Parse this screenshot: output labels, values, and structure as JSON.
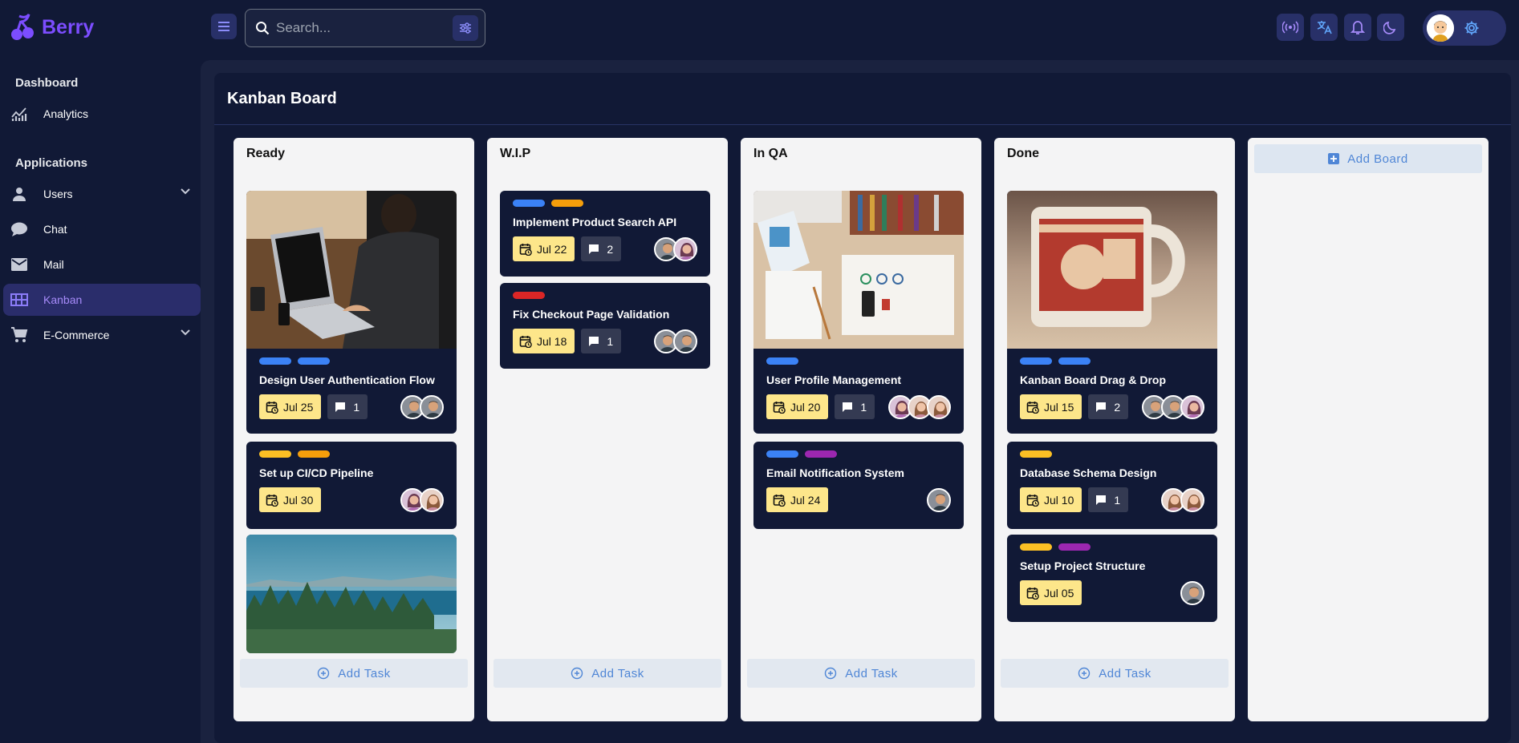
{
  "app": {
    "name": "Berry"
  },
  "search": {
    "placeholder": "Search..."
  },
  "sidebar": {
    "sections": [
      {
        "title": "Dashboard",
        "items": [
          {
            "label": "Analytics",
            "icon": "analytics-icon"
          }
        ]
      },
      {
        "title": "Applications",
        "items": [
          {
            "label": "Users",
            "icon": "user-icon",
            "expandable": true
          },
          {
            "label": "Chat",
            "icon": "chat-icon"
          },
          {
            "label": "Mail",
            "icon": "mail-icon"
          },
          {
            "label": "Kanban",
            "icon": "kanban-icon",
            "active": true
          },
          {
            "label": "E-Commerce",
            "icon": "cart-icon",
            "expandable": true
          }
        ]
      }
    ]
  },
  "header": {
    "icons": [
      "hamburger-icon",
      "tune-icon",
      "broadcast-icon",
      "translate-icon",
      "bell-icon",
      "moon-icon",
      "settings-icon"
    ]
  },
  "page": {
    "title": "Kanban Board"
  },
  "board": {
    "add_task_label": "Add Task",
    "add_board_label": "Add Board",
    "columns": [
      {
        "title": "Ready",
        "cards": [
          {
            "image": "laptop",
            "tags": [
              "blue",
              "blue"
            ],
            "title": "Design User Authentication Flow",
            "date": "Jul 25",
            "comments": "1",
            "avatars": 2
          },
          {
            "tags": [
              "yellow",
              "orange"
            ],
            "title": "Set up CI/CD Pipeline",
            "date": "Jul 30",
            "avatars": 2
          },
          {
            "image": "forest-lake"
          }
        ]
      },
      {
        "title": "W.I.P",
        "cards": [
          {
            "tags": [
              "blue",
              "orange"
            ],
            "title": "Implement Product Search API",
            "date": "Jul 22",
            "comments": "2",
            "avatars": 2
          },
          {
            "tags": [
              "red"
            ],
            "title": "Fix Checkout Page Validation",
            "date": "Jul 18",
            "comments": "1",
            "avatars": 2
          }
        ]
      },
      {
        "title": "In QA",
        "cards": [
          {
            "image": "desk",
            "tags": [
              "blue"
            ],
            "title": "User Profile Management",
            "date": "Jul 20",
            "comments": "1",
            "avatars": 3
          },
          {
            "tags": [
              "blue",
              "purple"
            ],
            "title": "Email Notification System",
            "date": "Jul 24",
            "avatars": 1
          }
        ]
      },
      {
        "title": "Done",
        "cards": [
          {
            "image": "mug",
            "tags": [
              "blue",
              "blue"
            ],
            "title": "Kanban Board Drag & Drop",
            "date": "Jul 15",
            "comments": "2",
            "avatars": 3
          },
          {
            "tags": [
              "yellow"
            ],
            "title": "Database Schema Design",
            "date": "Jul 10",
            "comments": "1",
            "avatars": 2
          },
          {
            "tags": [
              "yellow",
              "purple"
            ],
            "title": "Setup Project Structure",
            "date": "Jul 05",
            "avatars": 1
          }
        ]
      }
    ]
  },
  "colors": {
    "accent": "#7c4dff",
    "background": "#111936",
    "tag_blue": "#3b82f6",
    "tag_orange": "#f59e0b",
    "tag_yellow": "#fbbf24",
    "tag_red": "#dc2626",
    "tag_purple": "#9c27b0",
    "date_badge": "#fde68a"
  }
}
